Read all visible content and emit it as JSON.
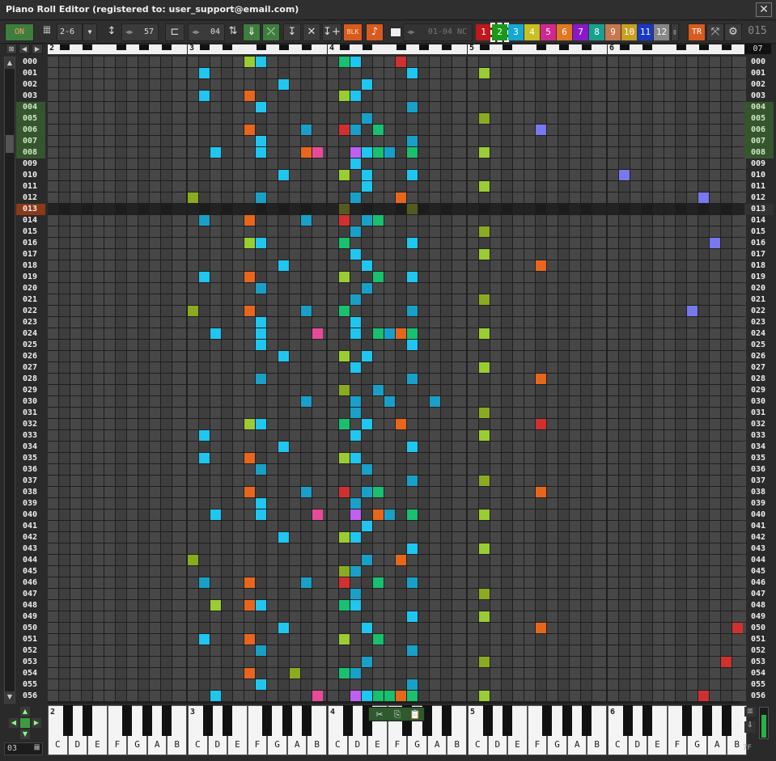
{
  "window": {
    "title": "Piano Roll Editor  (registered to: user_support@email.com)",
    "close_glyph": "✕"
  },
  "toolbar": {
    "on_label": "ON",
    "octave_range": "2-6",
    "dropdown_glyph": "▼",
    "row_height_value": "57",
    "step_value": "04",
    "blk_label": "BLK",
    "channel_display": "01-04  NC",
    "channel_buttons": [
      {
        "label": "1",
        "color": "#c0161c"
      },
      {
        "label": "2",
        "color": "#1a9a1a"
      },
      {
        "label": "3",
        "color": "#15a8d0"
      },
      {
        "label": "4",
        "color": "#c8c020"
      },
      {
        "label": "5",
        "color": "#d02890"
      },
      {
        "label": "6",
        "color": "#e07820"
      },
      {
        "label": "7",
        "color": "#8a18c8"
      },
      {
        "label": "8",
        "color": "#18a090"
      },
      {
        "label": "9",
        "color": "#c87850"
      },
      {
        "label": "10",
        "color": "#c8a020"
      },
      {
        "label": "11",
        "color": "#1838c8"
      },
      {
        "label": "12",
        "color": "#888888"
      }
    ],
    "tr_label": "TR",
    "counter": "015"
  },
  "ruler": {
    "octaves": [
      "2",
      "3",
      "4",
      "5",
      "6"
    ],
    "right_value": "07"
  },
  "rows": {
    "numbers": [
      "000",
      "001",
      "002",
      "003",
      "004",
      "005",
      "006",
      "007",
      "008",
      "009",
      "010",
      "011",
      "012",
      "013",
      "014",
      "015",
      "016",
      "017",
      "018",
      "019",
      "020",
      "021",
      "022",
      "023",
      "024",
      "025",
      "026",
      "027",
      "028",
      "029",
      "030",
      "031",
      "032",
      "033",
      "034",
      "035",
      "036",
      "037",
      "038",
      "039",
      "040",
      "041",
      "042",
      "043",
      "044",
      "045",
      "046",
      "047",
      "048",
      "049",
      "050",
      "051",
      "052",
      "053",
      "054",
      "055",
      "056"
    ],
    "highlighted_green": [
      4,
      5,
      6,
      7,
      8
    ],
    "cursor_row": 13
  },
  "keyboard": {
    "octaves": [
      "2",
      "3",
      "4",
      "5",
      "6"
    ],
    "note_names": [
      "C",
      "D",
      "E",
      "F",
      "G",
      "A",
      "B"
    ]
  },
  "bottom": {
    "left_value": "03",
    "right_value": "7F"
  },
  "colors": {
    "cyan": "#1fc6f0",
    "lime": "#9acd32",
    "orange": "#e8661c",
    "teal": "#19a0c8",
    "green": "#18c070",
    "red": "#d03030",
    "pink": "#e84a9a",
    "violet": "#c060f0",
    "purple": "#7878f0",
    "olive": "#8aab20"
  },
  "notes": [
    [
      0,
      17,
      "lime"
    ],
    [
      0,
      18,
      "cyan"
    ],
    [
      0,
      25,
      "green"
    ],
    [
      0,
      26,
      "cyan"
    ],
    [
      0,
      30,
      "red"
    ],
    [
      1,
      13,
      "cyan"
    ],
    [
      1,
      31,
      "cyan"
    ],
    [
      1,
      37,
      "lime"
    ],
    [
      2,
      20,
      "cyan"
    ],
    [
      2,
      27,
      "cyan"
    ],
    [
      3,
      13,
      "cyan"
    ],
    [
      3,
      17,
      "orange"
    ],
    [
      3,
      25,
      "lime"
    ],
    [
      3,
      26,
      "cyan"
    ],
    [
      4,
      18,
      "cyan"
    ],
    [
      4,
      31,
      "teal"
    ],
    [
      5,
      27,
      "teal"
    ],
    [
      5,
      37,
      "olive"
    ],
    [
      6,
      17,
      "orange"
    ],
    [
      6,
      22,
      "teal"
    ],
    [
      6,
      25,
      "red"
    ],
    [
      6,
      26,
      "teal"
    ],
    [
      6,
      28,
      "green"
    ],
    [
      6,
      42,
      "purple"
    ],
    [
      7,
      18,
      "cyan"
    ],
    [
      7,
      31,
      "teal"
    ],
    [
      8,
      14,
      "cyan"
    ],
    [
      8,
      18,
      "cyan"
    ],
    [
      8,
      22,
      "orange"
    ],
    [
      8,
      23,
      "pink"
    ],
    [
      8,
      26,
      "violet"
    ],
    [
      8,
      27,
      "cyan"
    ],
    [
      8,
      28,
      "green"
    ],
    [
      8,
      29,
      "teal"
    ],
    [
      8,
      31,
      "green"
    ],
    [
      8,
      37,
      "lime"
    ],
    [
      9,
      26,
      "cyan"
    ],
    [
      10,
      20,
      "cyan"
    ],
    [
      10,
      25,
      "lime"
    ],
    [
      10,
      27,
      "cyan"
    ],
    [
      10,
      31,
      "cyan"
    ],
    [
      10,
      49,
      "purple"
    ],
    [
      11,
      27,
      "cyan"
    ],
    [
      11,
      37,
      "lime"
    ],
    [
      12,
      12,
      "olive"
    ],
    [
      12,
      18,
      "teal"
    ],
    [
      12,
      26,
      "teal"
    ],
    [
      12,
      30,
      "orange"
    ],
    [
      12,
      56,
      "purple"
    ],
    [
      13,
      25,
      "olive"
    ],
    [
      13,
      31,
      "teal"
    ],
    [
      14,
      13,
      "teal"
    ],
    [
      14,
      17,
      "orange"
    ],
    [
      14,
      22,
      "teal"
    ],
    [
      14,
      25,
      "red"
    ],
    [
      14,
      27,
      "teal"
    ],
    [
      14,
      28,
      "green"
    ],
    [
      15,
      26,
      "teal"
    ],
    [
      15,
      37,
      "olive"
    ],
    [
      16,
      17,
      "lime"
    ],
    [
      16,
      18,
      "cyan"
    ],
    [
      16,
      25,
      "green"
    ],
    [
      16,
      31,
      "cyan"
    ],
    [
      16,
      57,
      "purple"
    ],
    [
      17,
      26,
      "cyan"
    ],
    [
      17,
      37,
      "lime"
    ],
    [
      18,
      20,
      "cyan"
    ],
    [
      18,
      27,
      "cyan"
    ],
    [
      18,
      42,
      "orange"
    ],
    [
      19,
      13,
      "cyan"
    ],
    [
      19,
      17,
      "orange"
    ],
    [
      19,
      25,
      "lime"
    ],
    [
      19,
      28,
      "green"
    ],
    [
      19,
      31,
      "cyan"
    ],
    [
      20,
      18,
      "teal"
    ],
    [
      20,
      27,
      "teal"
    ],
    [
      21,
      26,
      "teal"
    ],
    [
      21,
      37,
      "olive"
    ],
    [
      22,
      12,
      "olive"
    ],
    [
      22,
      17,
      "orange"
    ],
    [
      22,
      22,
      "teal"
    ],
    [
      22,
      25,
      "green"
    ],
    [
      22,
      31,
      "teal"
    ],
    [
      22,
      55,
      "purple"
    ],
    [
      23,
      18,
      "cyan"
    ],
    [
      23,
      26,
      "cyan"
    ],
    [
      24,
      14,
      "cyan"
    ],
    [
      24,
      18,
      "cyan"
    ],
    [
      24,
      23,
      "pink"
    ],
    [
      24,
      26,
      "cyan"
    ],
    [
      24,
      28,
      "green"
    ],
    [
      24,
      29,
      "teal"
    ],
    [
      24,
      30,
      "orange"
    ],
    [
      24,
      31,
      "green"
    ],
    [
      24,
      37,
      "lime"
    ],
    [
      25,
      18,
      "cyan"
    ],
    [
      25,
      31,
      "cyan"
    ],
    [
      26,
      20,
      "cyan"
    ],
    [
      26,
      25,
      "lime"
    ],
    [
      26,
      27,
      "cyan"
    ],
    [
      27,
      26,
      "cyan"
    ],
    [
      27,
      37,
      "lime"
    ],
    [
      28,
      18,
      "teal"
    ],
    [
      28,
      31,
      "teal"
    ],
    [
      28,
      42,
      "orange"
    ],
    [
      29,
      25,
      "olive"
    ],
    [
      29,
      28,
      "teal"
    ],
    [
      30,
      22,
      "teal"
    ],
    [
      30,
      26,
      "teal"
    ],
    [
      30,
      29,
      "teal"
    ],
    [
      30,
      33,
      "teal"
    ],
    [
      31,
      26,
      "teal"
    ],
    [
      31,
      37,
      "olive"
    ],
    [
      32,
      17,
      "lime"
    ],
    [
      32,
      18,
      "cyan"
    ],
    [
      32,
      25,
      "green"
    ],
    [
      32,
      27,
      "cyan"
    ],
    [
      32,
      30,
      "orange"
    ],
    [
      32,
      42,
      "red"
    ],
    [
      33,
      13,
      "cyan"
    ],
    [
      33,
      26,
      "cyan"
    ],
    [
      33,
      37,
      "lime"
    ],
    [
      34,
      20,
      "cyan"
    ],
    [
      34,
      31,
      "cyan"
    ],
    [
      35,
      13,
      "cyan"
    ],
    [
      35,
      17,
      "orange"
    ],
    [
      35,
      25,
      "lime"
    ],
    [
      35,
      26,
      "cyan"
    ],
    [
      36,
      18,
      "teal"
    ],
    [
      36,
      27,
      "teal"
    ],
    [
      37,
      31,
      "teal"
    ],
    [
      37,
      37,
      "olive"
    ],
    [
      38,
      17,
      "orange"
    ],
    [
      38,
      22,
      "teal"
    ],
    [
      38,
      25,
      "red"
    ],
    [
      38,
      27,
      "teal"
    ],
    [
      38,
      28,
      "green"
    ],
    [
      38,
      42,
      "orange"
    ],
    [
      39,
      18,
      "cyan"
    ],
    [
      39,
      26,
      "teal"
    ],
    [
      40,
      14,
      "cyan"
    ],
    [
      40,
      18,
      "cyan"
    ],
    [
      40,
      23,
      "pink"
    ],
    [
      40,
      26,
      "violet"
    ],
    [
      40,
      28,
      "orange"
    ],
    [
      40,
      29,
      "teal"
    ],
    [
      40,
      31,
      "green"
    ],
    [
      40,
      37,
      "lime"
    ],
    [
      41,
      27,
      "cyan"
    ],
    [
      42,
      20,
      "cyan"
    ],
    [
      42,
      25,
      "lime"
    ],
    [
      42,
      26,
      "cyan"
    ],
    [
      43,
      31,
      "cyan"
    ],
    [
      43,
      37,
      "lime"
    ],
    [
      44,
      12,
      "olive"
    ],
    [
      44,
      27,
      "teal"
    ],
    [
      44,
      30,
      "orange"
    ],
    [
      45,
      25,
      "olive"
    ],
    [
      45,
      26,
      "teal"
    ],
    [
      46,
      13,
      "teal"
    ],
    [
      46,
      17,
      "orange"
    ],
    [
      46,
      22,
      "teal"
    ],
    [
      46,
      25,
      "red"
    ],
    [
      46,
      28,
      "green"
    ],
    [
      46,
      31,
      "teal"
    ],
    [
      47,
      26,
      "teal"
    ],
    [
      47,
      37,
      "olive"
    ],
    [
      48,
      14,
      "lime"
    ],
    [
      48,
      17,
      "orange"
    ],
    [
      48,
      18,
      "cyan"
    ],
    [
      48,
      25,
      "green"
    ],
    [
      48,
      26,
      "cyan"
    ],
    [
      49,
      31,
      "cyan"
    ],
    [
      49,
      37,
      "lime"
    ],
    [
      50,
      20,
      "cyan"
    ],
    [
      50,
      27,
      "cyan"
    ],
    [
      50,
      42,
      "orange"
    ],
    [
      50,
      59,
      "red"
    ],
    [
      51,
      13,
      "cyan"
    ],
    [
      51,
      17,
      "orange"
    ],
    [
      51,
      25,
      "lime"
    ],
    [
      51,
      28,
      "green"
    ],
    [
      52,
      18,
      "teal"
    ],
    [
      52,
      31,
      "teal"
    ],
    [
      53,
      27,
      "teal"
    ],
    [
      53,
      37,
      "olive"
    ],
    [
      53,
      58,
      "red"
    ],
    [
      54,
      17,
      "orange"
    ],
    [
      54,
      21,
      "olive"
    ],
    [
      54,
      25,
      "green"
    ],
    [
      54,
      26,
      "teal"
    ],
    [
      55,
      18,
      "cyan"
    ],
    [
      55,
      31,
      "teal"
    ],
    [
      56,
      14,
      "cyan"
    ],
    [
      56,
      23,
      "pink"
    ],
    [
      56,
      26,
      "violet"
    ],
    [
      56,
      27,
      "cyan"
    ],
    [
      56,
      28,
      "green"
    ],
    [
      56,
      29,
      "green"
    ],
    [
      56,
      30,
      "orange"
    ],
    [
      56,
      31,
      "green"
    ],
    [
      56,
      37,
      "lime"
    ],
    [
      56,
      56,
      "red"
    ]
  ]
}
